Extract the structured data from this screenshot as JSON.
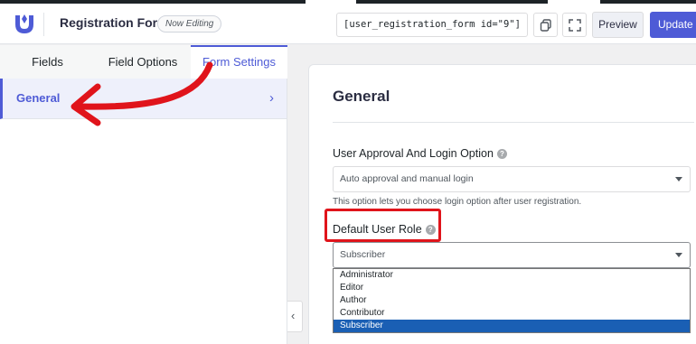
{
  "header": {
    "form_title": "Registration Form",
    "status_badge": "Now Editing",
    "shortcode": "[user_registration_form id=\"9\"]",
    "preview_label": "Preview",
    "update_label": "Update form",
    "icons": [
      "user-registration-logo-icon",
      "copy-icon",
      "fullscreen-icon"
    ]
  },
  "sidebar": {
    "tabs": [
      {
        "label": "Fields"
      },
      {
        "label": "Field Options"
      },
      {
        "label": "Form Settings",
        "active": true
      }
    ],
    "nav": {
      "label": "General",
      "chevron": "›"
    },
    "collapse_glyph": "‹"
  },
  "main": {
    "section_title": "General",
    "approval": {
      "label": "User Approval And Login Option",
      "value": "Auto approval and manual login",
      "help": "This option lets you choose login option after user registration."
    },
    "role": {
      "label": "Default User Role",
      "value": "Subscriber",
      "options": [
        "Administrator",
        "Editor",
        "Author",
        "Contributor",
        "Subscriber"
      ],
      "selected": "Subscriber"
    },
    "help_glyph": "?"
  },
  "colors": {
    "accent": "#4e5bd6",
    "annotation": "#e0141b",
    "selected_option": "#1a5fb4"
  }
}
